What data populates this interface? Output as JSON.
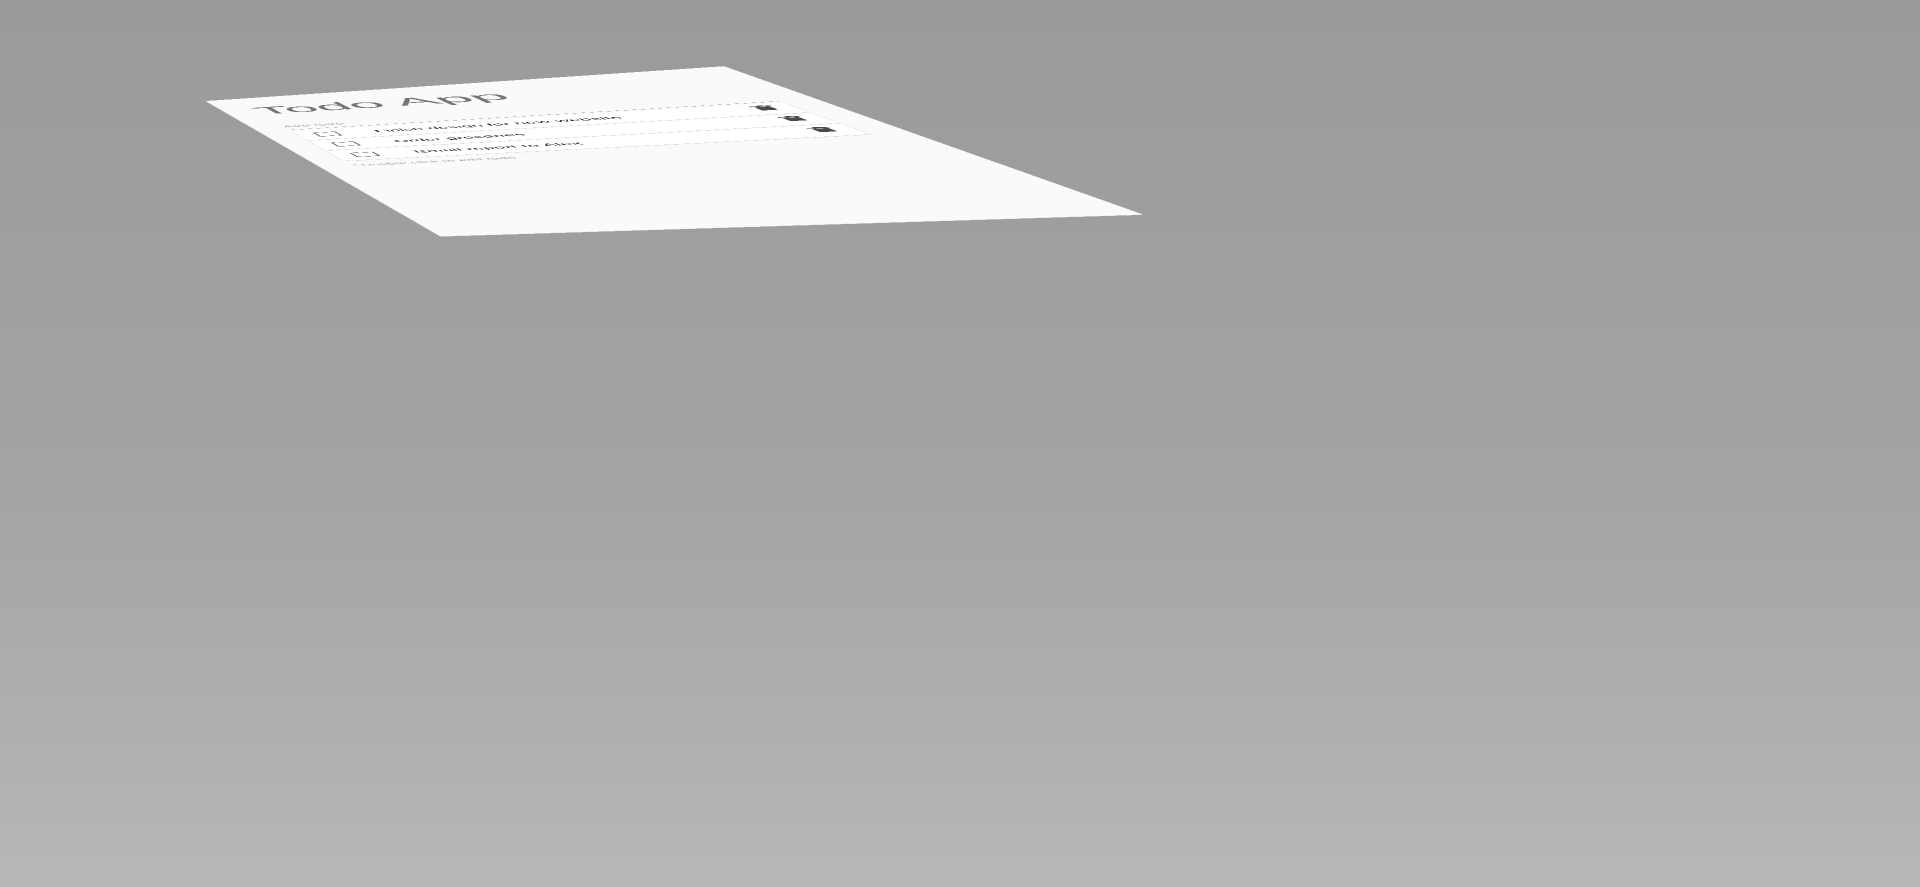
{
  "app": {
    "title": "Todo App"
  },
  "add_todo": {
    "placeholder": "Add todo",
    "value": ""
  },
  "todos": [
    {
      "text": "Finish design for new website",
      "done": false
    },
    {
      "text": "Order groceries",
      "done": false
    },
    {
      "text": "Email report to Alex",
      "done": false
    }
  ],
  "hint": "* Double click to edit todo",
  "icons": {
    "delete": "trash-icon",
    "complete": "checkbox-icon"
  },
  "colors": {
    "background": "#a3a3a3",
    "panel": "#fafafa",
    "title": "#757575",
    "icon": "#4a4a4a"
  }
}
